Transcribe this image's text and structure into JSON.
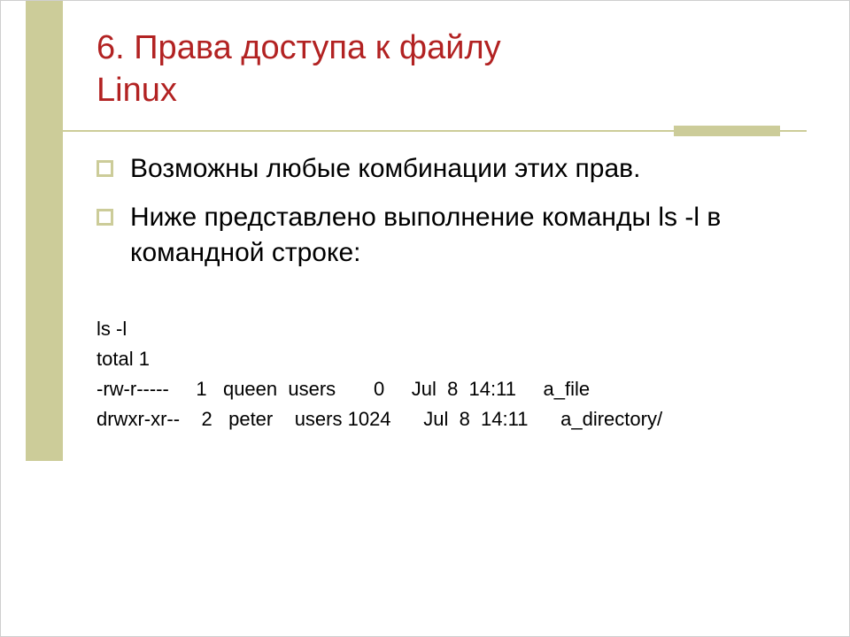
{
  "title_line1": "6. Права доступа к файлу",
  "title_line2": "Linux",
  "bullets": {
    "b1": "Возможны любые комбинации этих прав.",
    "b2": "Ниже представлено выполнение команды ls -l в командной строке:"
  },
  "listing": {
    "l1": "ls -l",
    "l2": "total 1",
    "l3": "-rw-r-----     1   queen  users       0     Jul  8  14:11     a_file",
    "l4": "drwxr-xr--    2   peter    users 1024      Jul  8  14:11      a_directory/"
  }
}
